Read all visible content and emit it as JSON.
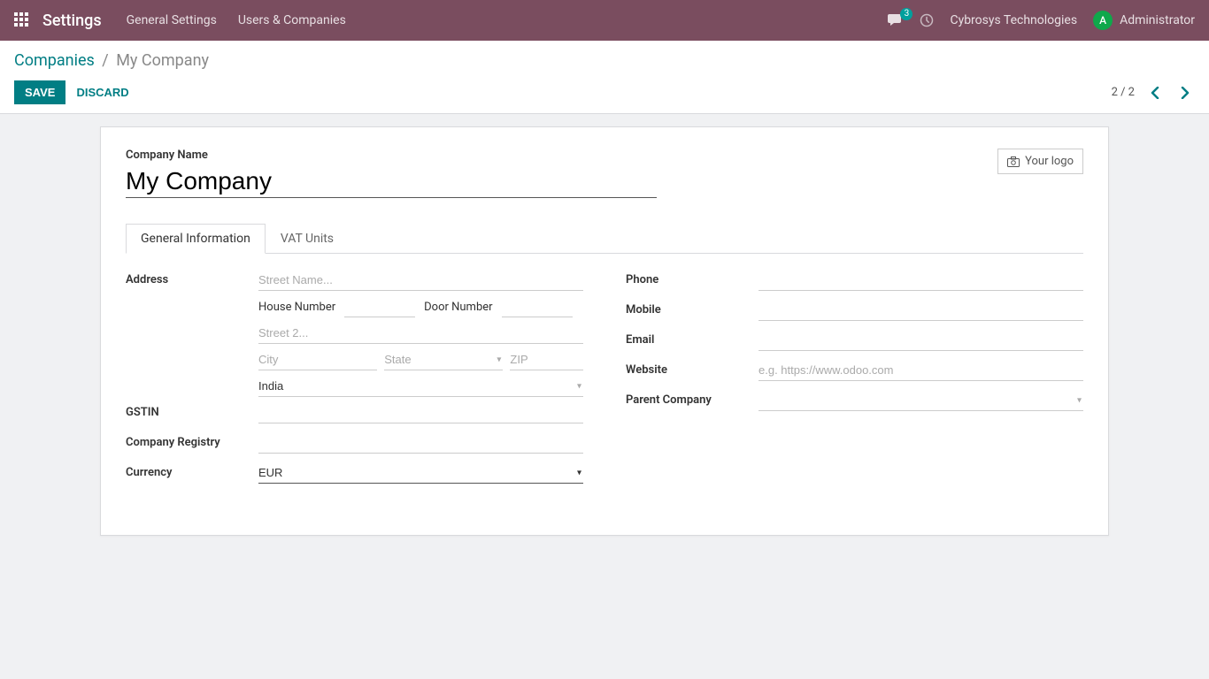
{
  "navbar": {
    "brand": "Settings",
    "links": [
      "General Settings",
      "Users & Companies"
    ],
    "badge_count": "3",
    "company": "Cybrosys Technologies",
    "user_initial": "A",
    "user_name": "Administrator"
  },
  "breadcrumb": {
    "parent": "Companies",
    "current": "My Company"
  },
  "actions": {
    "save": "SAVE",
    "discard": "DISCARD"
  },
  "pager": {
    "text": "2 / 2"
  },
  "form": {
    "title_label": "Company Name",
    "title_value": "My Company",
    "logo_label": "Your logo"
  },
  "tabs": [
    "General Information",
    "VAT Units"
  ],
  "fields": {
    "left": {
      "address_label": "Address",
      "street_placeholder": "Street Name...",
      "house_number_label": "House Number",
      "door_number_label": "Door Number",
      "street2_placeholder": "Street 2...",
      "city_placeholder": "City",
      "state_placeholder": "State",
      "zip_placeholder": "ZIP",
      "country_value": "India",
      "gstin_label": "GSTIN",
      "company_registry_label": "Company Registry",
      "currency_label": "Currency",
      "currency_value": "EUR"
    },
    "right": {
      "phone_label": "Phone",
      "mobile_label": "Mobile",
      "email_label": "Email",
      "website_label": "Website",
      "website_placeholder": "e.g. https://www.odoo.com",
      "parent_company_label": "Parent Company"
    }
  }
}
